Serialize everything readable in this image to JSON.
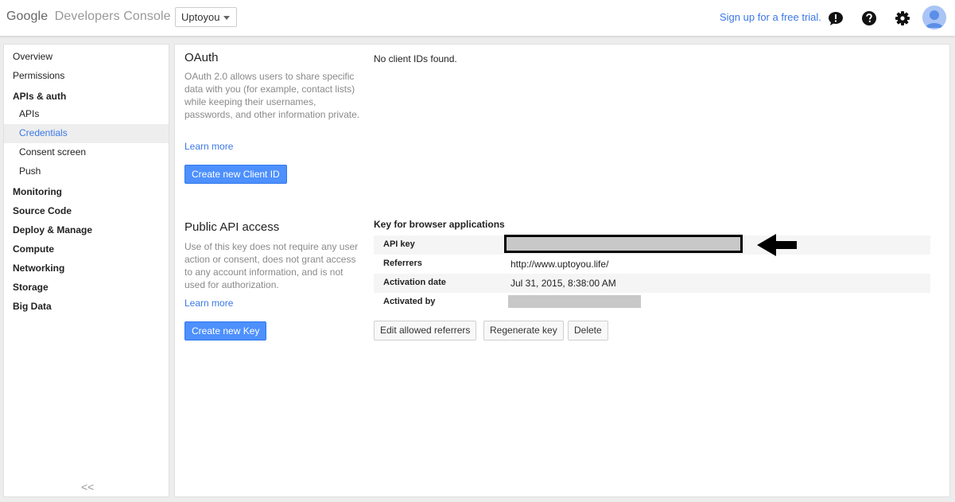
{
  "header": {
    "logo_google": "Google",
    "logo_product": "Developers Console",
    "project": "Uptoyou",
    "signup": "Sign up for a free trial."
  },
  "icons": {
    "feedback": "feedback-icon",
    "help": "help-icon",
    "settings": "gear-icon",
    "avatar": "avatar",
    "collapse": "collapse-icon",
    "arrow": "arrow-left-icon"
  },
  "colors": {
    "accent": "#3b78e7",
    "button_blue": "#4d90fe"
  },
  "sidebar": {
    "items": [
      {
        "label": "Overview"
      },
      {
        "label": "Permissions"
      },
      {
        "label": "APIs & auth"
      },
      {
        "label": "APIs"
      },
      {
        "label": "Credentials"
      },
      {
        "label": "Consent screen"
      },
      {
        "label": "Push"
      },
      {
        "label": "Monitoring"
      },
      {
        "label": "Source Code"
      },
      {
        "label": "Deploy & Manage"
      },
      {
        "label": "Compute"
      },
      {
        "label": "Networking"
      },
      {
        "label": "Storage"
      },
      {
        "label": "Big Data"
      }
    ],
    "collapse": "<<"
  },
  "oauth": {
    "title": "OAuth",
    "desc": "OAuth 2.0 allows users to share specific data with you (for example, contact lists) while keeping their usernames, passwords, and other information private.",
    "learn_more": "Learn more",
    "button": "Create new Client ID",
    "empty": "No client IDs found."
  },
  "public_api": {
    "title": "Public API access",
    "desc": "Use of this key does not require any user action or consent, does not grant access to any account information, and is not used for authorization.",
    "learn_more": "Learn more",
    "button": "Create new Key"
  },
  "key": {
    "title": "Key for browser applications",
    "rows": [
      {
        "label": "API key",
        "value": ""
      },
      {
        "label": "Referrers",
        "value": "http://www.uptoyou.life/"
      },
      {
        "label": "Activation date",
        "value": "Jul 31, 2015, 8:38:00 AM"
      },
      {
        "label": "Activated by",
        "value": ""
      }
    ],
    "buttons": [
      "Edit allowed referrers",
      "Regenerate key",
      "Delete"
    ]
  }
}
